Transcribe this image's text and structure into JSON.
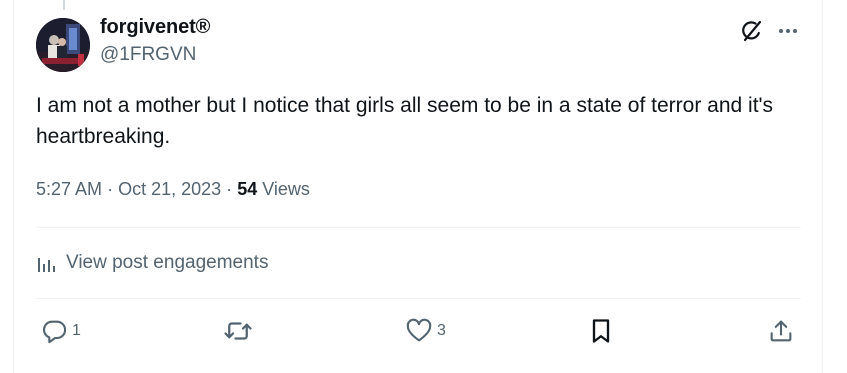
{
  "author": {
    "display_name": "forgivenet®",
    "handle": "@1FRGVN"
  },
  "tweet": {
    "text": "I am not a mother but I notice that girls all seem to be in a state of terror and it's heartbreaking.",
    "time": "5:27 AM",
    "date": "Oct 21, 2023",
    "separator": "·",
    "views_count": "54",
    "views_label": "Views"
  },
  "engagements_label": "View post engagements",
  "actions": {
    "reply_count": "1",
    "repost_count": "",
    "like_count": "3"
  },
  "icons": [
    "grok-icon",
    "more-icon",
    "analytics-icon",
    "reply-icon",
    "repost-icon",
    "like-icon",
    "bookmark-icon",
    "share-icon"
  ],
  "colors": {
    "text": "#0f1419",
    "secondary": "#536471",
    "divider": "#eff3f4"
  }
}
